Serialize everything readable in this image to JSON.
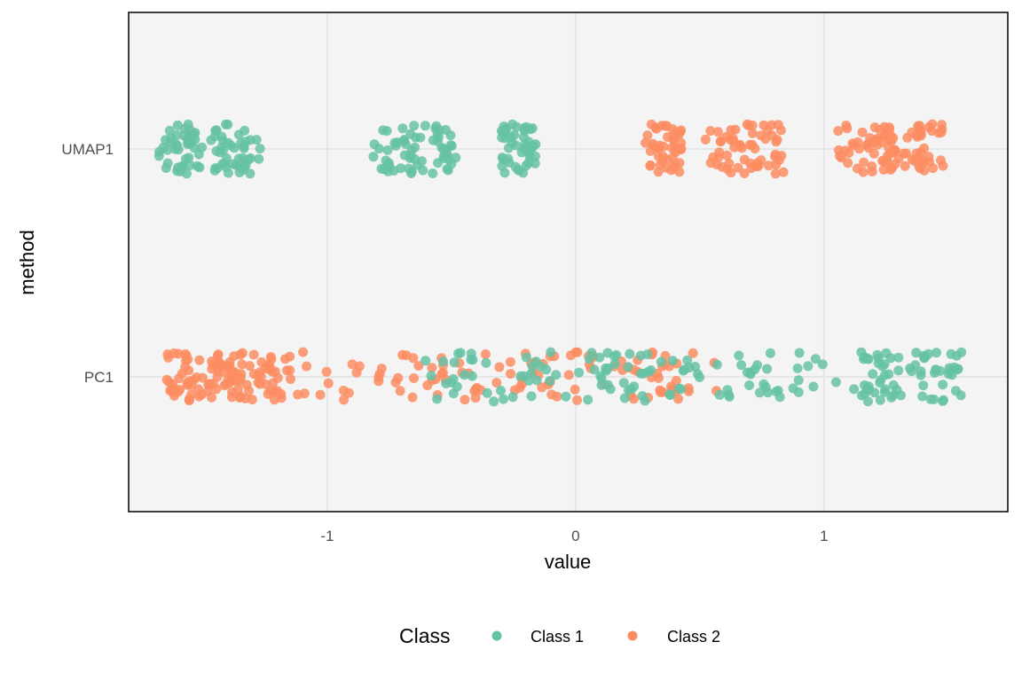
{
  "chart_data": {
    "type": "scatter",
    "subtype": "jittered strip plot",
    "title": "",
    "xlabel": "value",
    "ylabel": "method",
    "xlim": [
      -1.8,
      1.74
    ],
    "x_ticks": [
      -1,
      0,
      1
    ],
    "x_tick_labels": [
      "-1",
      "0",
      "1"
    ],
    "categories": [
      "UMAP1",
      "PC1"
    ],
    "grid": true,
    "legend": {
      "title": "Class",
      "position": "bottom",
      "entries": [
        "Class 1",
        "Class 2"
      ]
    },
    "colors": {
      "Class 1": "#66c2a5",
      "Class 2": "#fc8d62"
    },
    "series": [
      {
        "name": "Class 1",
        "method": "UMAP1",
        "clusters": [
          {
            "x_min": -1.68,
            "x_max": -1.5,
            "n": 45
          },
          {
            "x_min": -1.47,
            "x_max": -1.27,
            "n": 45
          },
          {
            "x_min": -0.82,
            "x_max": -0.6,
            "n": 40
          },
          {
            "x_min": -0.58,
            "x_max": -0.48,
            "n": 25
          },
          {
            "x_min": -0.3,
            "x_max": -0.16,
            "n": 45
          }
        ]
      },
      {
        "name": "Class 2",
        "method": "UMAP1",
        "clusters": [
          {
            "x_min": 0.28,
            "x_max": 0.43,
            "n": 45
          },
          {
            "x_min": 0.52,
            "x_max": 0.84,
            "n": 60
          },
          {
            "x_min": 1.04,
            "x_max": 1.26,
            "n": 40
          },
          {
            "x_min": 1.26,
            "x_max": 1.5,
            "n": 50
          }
        ]
      },
      {
        "name": "Class 2",
        "method": "PC1",
        "clusters": [
          {
            "x_min": -1.65,
            "x_max": -1.2,
            "n": 110
          },
          {
            "x_min": -1.2,
            "x_max": -0.75,
            "n": 25
          },
          {
            "x_min": -0.75,
            "x_max": 0.45,
            "n": 90
          },
          {
            "x_min": 0.45,
            "x_max": 0.58,
            "n": 5
          }
        ]
      },
      {
        "name": "Class 1",
        "method": "PC1",
        "clusters": [
          {
            "x_min": -0.62,
            "x_max": 0.45,
            "n": 80
          },
          {
            "x_min": 0.45,
            "x_max": 0.9,
            "n": 30
          },
          {
            "x_min": 0.9,
            "x_max": 1.1,
            "n": 6
          },
          {
            "x_min": 1.1,
            "x_max": 1.56,
            "n": 70
          }
        ]
      }
    ]
  }
}
